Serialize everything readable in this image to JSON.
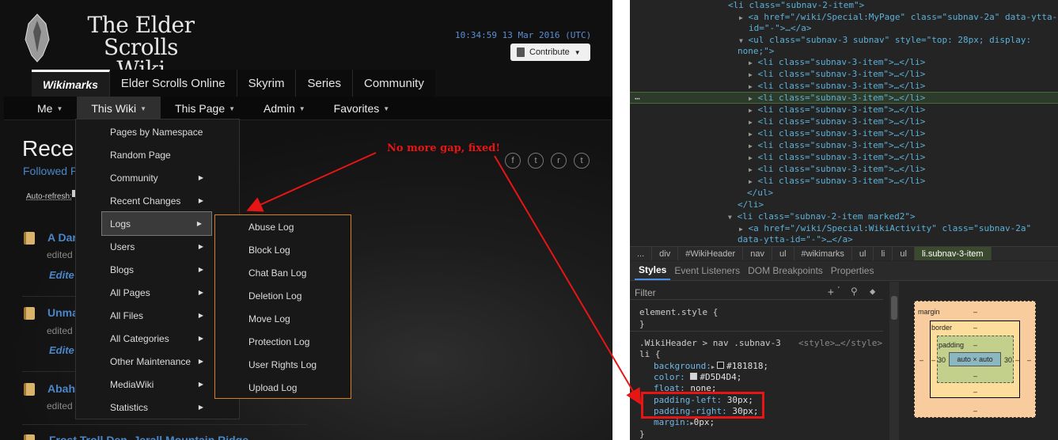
{
  "wiki": {
    "logo_line1": "The Elder Scrolls",
    "logo_line2": "Wiki",
    "clock": "10:34:59 13 Mar 2016 (UTC)",
    "contribute": "Contribute",
    "tabs": [
      "Wikimarks",
      "Elder Scrolls Online",
      "Skyrim",
      "Series",
      "Community"
    ],
    "subnav": [
      "Me",
      "This Wiki",
      "This Page",
      "Admin",
      "Favorites"
    ],
    "page_title": "Rece",
    "followed": "Followed P",
    "auto_refresh": "Auto-refresh:",
    "social_icons": [
      "facebook-icon",
      "twitter-icon",
      "reddit-icon",
      "tumblr-icon"
    ],
    "recent_items": [
      {
        "title": "A Dar",
        "edited": "edited",
        "link": "Edite"
      },
      {
        "title": "Unma",
        "edited": "edited",
        "link": "Edite"
      },
      {
        "title": "Abah",
        "edited": "edited",
        "link": ""
      },
      {
        "title": "Frost Troll Den, Jerall Mountain Ridge",
        "edited": "",
        "link": ""
      }
    ],
    "menu_this_wiki": [
      {
        "label": "Pages by Namespace",
        "submenu": false
      },
      {
        "label": "Random Page",
        "submenu": false
      },
      {
        "label": "Community",
        "submenu": true
      },
      {
        "label": "Recent Changes",
        "submenu": true
      },
      {
        "label": "Logs",
        "submenu": true
      },
      {
        "label": "Users",
        "submenu": true
      },
      {
        "label": "Blogs",
        "submenu": true
      },
      {
        "label": "All Pages",
        "submenu": true
      },
      {
        "label": "All Files",
        "submenu": true
      },
      {
        "label": "All Categories",
        "submenu": true
      },
      {
        "label": "Other Maintenance",
        "submenu": true
      },
      {
        "label": "MediaWiki",
        "submenu": true
      },
      {
        "label": "Statistics",
        "submenu": true
      }
    ],
    "menu_logs": [
      "Abuse Log",
      "Block Log",
      "Chat Ban Log",
      "Deletion Log",
      "Move Log",
      "Protection Log",
      "User Rights Log",
      "Upload Log"
    ],
    "annotation": "No more gap, fixed!"
  },
  "devtools": {
    "dom_lines": [
      "<li class=\"subnav-2-item\">",
      "<a href=\"/wiki/Special:MyPage\" class=\"subnav-2a\" data-ytta-",
      "id=\"-\">…</a>",
      "<ul class=\"subnav-3 subnav\" style=\"top: 28px; display:",
      "none;\">",
      "<li class=\"subnav-3-item\">…</li>",
      "<li class=\"subnav-3-item\">…</li>",
      "<li class=\"subnav-3-item\">…</li>",
      "<li class=\"subnav-3-item\">…</li>",
      "<li class=\"subnav-3-item\">…</li>",
      "<li class=\"subnav-3-item\">…</li>",
      "<li class=\"subnav-3-item\">…</li>",
      "<li class=\"subnav-3-item\">…</li>",
      "<li class=\"subnav-3-item\">…</li>",
      "<li class=\"subnav-3-item\">…</li>",
      "<li class=\"subnav-3-item\">…</li>",
      "</ul>",
      "</li>",
      "<li class=\"subnav-2-item marked2\">",
      "<a href=\"/wiki/Special:WikiActivity\" class=\"subnav-2a\"",
      "data-ytta-id=\"-\">…</a>"
    ],
    "breadcrumbs": [
      "...",
      "div",
      "#WikiHeader",
      "nav",
      "ul",
      "#wikimarks",
      "ul",
      "li",
      "ul",
      "li.subnav-3-item"
    ],
    "tabs": [
      "Styles",
      "Event Listeners",
      "DOM Breakpoints",
      "Properties"
    ],
    "filter_placeholder": "Filter",
    "element_style": "element.style {",
    "close_brace": "}",
    "rule_selector": ".WikiHeader > nav .subnav-3",
    "rule_selector2": "li {",
    "rule_source": "<style>…</style>",
    "declarations": [
      {
        "prop": "background:",
        "val": "#181818;",
        "swatch": "#181818"
      },
      {
        "prop": "color:",
        "val": "#D5D4D4;",
        "swatch": "#D5D4D4"
      },
      {
        "prop": "float:",
        "val": "none;"
      },
      {
        "prop": "padding-left:",
        "val": "30px;"
      },
      {
        "prop": "padding-right:",
        "val": "30px;"
      },
      {
        "prop": "margin:",
        "val": "0px;"
      }
    ],
    "boxmodel": {
      "margin_label": "margin",
      "border_label": "border",
      "padding_label": "padding",
      "content": "auto × auto",
      "padding_left": "30",
      "padding_right": "30",
      "dash": "–"
    }
  }
}
